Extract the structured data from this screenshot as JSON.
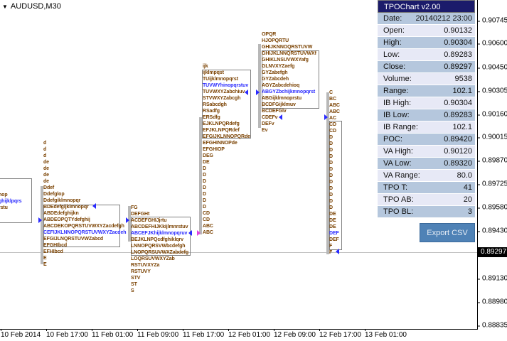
{
  "window": {
    "title": "AUDUSD,M30"
  },
  "panel": {
    "title": "TPOChart v2.00",
    "rows": [
      {
        "label": "Date:",
        "value": "20140212 23:00"
      },
      {
        "label": "Open:",
        "value": "0.90132"
      },
      {
        "label": "High:",
        "value": "0.90304"
      },
      {
        "label": "Low:",
        "value": "0.89283"
      },
      {
        "label": "Close:",
        "value": "0.89297"
      },
      {
        "label": "Volume:",
        "value": "9538"
      },
      {
        "label": "Range:",
        "value": "102.1"
      },
      {
        "label": "IB High:",
        "value": "0.90304"
      },
      {
        "label": "IB Low:",
        "value": "0.89283"
      },
      {
        "label": "IB Range:",
        "value": "102.1"
      },
      {
        "label": "POC:",
        "value": "0.89420"
      },
      {
        "label": "VA High:",
        "value": "0.90120"
      },
      {
        "label": "VA Low:",
        "value": "0.89320"
      },
      {
        "label": "VA Range:",
        "value": "80.0"
      },
      {
        "label": "TPO T:",
        "value": "41"
      },
      {
        "label": "TPO AB:",
        "value": "20"
      },
      {
        "label": "TPO BL:",
        "value": "3"
      }
    ],
    "export_label": "Export CSV"
  },
  "price_axis": [
    "0.90745",
    "0.90600",
    "0.90450",
    "0.90305",
    "0.90160",
    "0.90015",
    "0.89870",
    "0.89725",
    "0.89580",
    "0.89430",
    "0.89130",
    "0.88980",
    "0.88835"
  ],
  "current_price": "0.89297",
  "time_axis": [
    "10 Feb 2014",
    "10 Feb 17:00",
    "11 Feb 01:00",
    "11 Feb 09:00",
    "11 Feb 17:00",
    "12 Feb 01:00",
    "12 Feb 09:00",
    "12 Feb 17:00",
    "13 Feb 01:00"
  ],
  "colors": {
    "tpo": "#7a4100",
    "poc": "#2a2aff",
    "panel_header": "#1b1b6b",
    "button": "#4f82b6"
  },
  "profiles": [
    {
      "rows": [
        {
          "t": "nop"
        },
        {
          "t": "ghijklpqrs",
          "hl": true
        },
        {
          "t": "rstu"
        }
      ]
    },
    {
      "rows": [
        {
          "t": "d"
        },
        {
          "t": "d"
        },
        {
          "t": "d"
        },
        {
          "t": "de"
        },
        {
          "t": "de"
        },
        {
          "t": "de"
        },
        {
          "t": "de"
        },
        {
          "t": "Ddef"
        },
        {
          "t": "Ddefglop"
        },
        {
          "t": "Ddefgiklmnopqr"
        },
        {
          "t": "BDEdefgijklmnopqr"
        },
        {
          "t": "ABDEdefghijkn"
        },
        {
          "t": "ABDEOPQTYdefghij"
        },
        {
          "t": "ABCDEKOPQRSTUVWXYZacdefgh"
        },
        {
          "t": "CEFIJKLNNOPQRSTUVWXYZacdeh",
          "hl": true
        },
        {
          "t": "EFGIJLNQRSTUVWZabcd"
        },
        {
          "t": "EFGHIbcd"
        },
        {
          "t": "EFHIbcd"
        },
        {
          "t": "E"
        },
        {
          "t": "E"
        }
      ]
    },
    {
      "rows": [
        {
          "t": "FG"
        },
        {
          "t": "DEFGHt"
        },
        {
          "t": "ACDEFGHIJjrtu"
        },
        {
          "t": "ABCDEFHIJKkijlmnrstuv"
        },
        {
          "t": "ABCEFJKhijklmnopqruv",
          "hl": true
        },
        {
          "t": "BEJKLNPQcdfghiklqrv"
        },
        {
          "t": "LNNOPQRSVWbcdefgh"
        },
        {
          "t": "LNOPQRSUVWXZabdefg"
        },
        {
          "t": "LOQRSUVWXYZab"
        },
        {
          "t": "RSTUVXYZa"
        },
        {
          "t": "RSTUVY"
        },
        {
          "t": "STV"
        },
        {
          "t": "ST"
        },
        {
          "t": "S"
        }
      ]
    },
    {
      "rows": [
        {
          "t": "ijk"
        },
        {
          "t": "ijklmpqst"
        },
        {
          "t": "TUijklmnopqrst"
        },
        {
          "t": "TUVWYhinopqrstuv",
          "hl": true
        },
        {
          "t": "TUVWXYZabchiuv"
        },
        {
          "t": "STVWXYZabcgh"
        },
        {
          "t": "RSabcdgh"
        },
        {
          "t": "RSadfg"
        },
        {
          "t": "ERSdfg"
        },
        {
          "t": "EJKLNPQRdefg"
        },
        {
          "t": "EFJKLNPQRdef"
        },
        {
          "t": "EFGIJKLNNOPQRde"
        },
        {
          "t": "EFGHINNOPde"
        },
        {
          "t": "EFGHIOP"
        },
        {
          "t": "DEG"
        },
        {
          "t": "DE"
        },
        {
          "t": "D"
        },
        {
          "t": "D"
        },
        {
          "t": "D"
        },
        {
          "t": "D"
        },
        {
          "t": "D"
        },
        {
          "t": "D"
        },
        {
          "t": "D"
        },
        {
          "t": "CD"
        },
        {
          "t": "CD"
        },
        {
          "t": "ABC"
        },
        {
          "t": "ABC"
        }
      ]
    },
    {
      "rows": [
        {
          "t": "OPQR"
        },
        {
          "t": "HJOPQRTU"
        },
        {
          "t": "GHIJKNNOQRSTUVW"
        },
        {
          "t": "GHIJKLNNQRSTUVWXf"
        },
        {
          "t": "GHIKLNSUVWXYafg"
        },
        {
          "t": "GLNVXYZaefg"
        },
        {
          "t": "GYZabefgh"
        },
        {
          "t": "GYZabcdeh"
        },
        {
          "t": "AGYZabcdehioq"
        },
        {
          "t": "ABGYZbchijkmnopqrst",
          "hl": true
        },
        {
          "t": "ABGijklmnoprstu"
        },
        {
          "t": "BCDFGijklmuv"
        },
        {
          "t": "BCDEFGlv"
        },
        {
          "t": "CDEFv"
        },
        {
          "t": "DEFv"
        },
        {
          "t": "Ev"
        }
      ]
    },
    {
      "rows": [
        {
          "t": "C"
        },
        {
          "t": "BC"
        },
        {
          "t": "ABC"
        },
        {
          "t": "ABC"
        },
        {
          "t": "AC"
        },
        {
          "t": "CD"
        },
        {
          "t": "CD"
        },
        {
          "t": "D"
        },
        {
          "t": "D"
        },
        {
          "t": "D"
        },
        {
          "t": "D"
        },
        {
          "t": "D"
        },
        {
          "t": "D"
        },
        {
          "t": "D"
        },
        {
          "t": "D"
        },
        {
          "t": "D"
        },
        {
          "t": "D"
        },
        {
          "t": "D"
        },
        {
          "t": "D"
        },
        {
          "t": "DE"
        },
        {
          "t": "DE"
        },
        {
          "t": "DE"
        },
        {
          "t": "DEF",
          "hl": true
        },
        {
          "t": "DEF"
        },
        {
          "t": "F"
        },
        {
          "t": "F"
        }
      ]
    }
  ]
}
